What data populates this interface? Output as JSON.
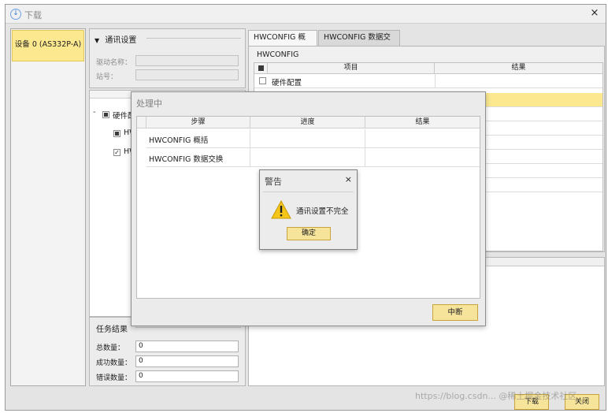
{
  "window": {
    "title": "下载",
    "close": "×"
  },
  "device": {
    "item": "设备 0 (AS332P-A)"
  },
  "comm": {
    "title": "通讯设置",
    "driver_label": "驱动名称：",
    "station_label": "站号："
  },
  "tree": {
    "collapse": "-",
    "root": "硬件配",
    "child1": "HW",
    "child2": "HW"
  },
  "results": {
    "title": "任务结果",
    "total_label": "总数量：",
    "total": "0",
    "success_label": "成功数量：",
    "success": "0",
    "error_label": "错误数量：",
    "error": "0"
  },
  "tabs": [
    {
      "label": "HWCONFIG 概括"
    },
    {
      "label": "HWCONFIG 数据交换"
    }
  ],
  "hwconfig": {
    "label": "HWCONFIG",
    "col_item": "项目",
    "col_result": "结果",
    "row1": "硬件配置"
  },
  "buttons": {
    "download": "下载",
    "close": "关闭"
  },
  "processing": {
    "title": "处理中",
    "col_step": "步骤",
    "col_progress": "进度",
    "col_result": "结果",
    "rows": [
      {
        "step": "HWCONFIG 概括"
      },
      {
        "step": "HWCONFIG 数据交换"
      }
    ],
    "abort": "中断"
  },
  "warning": {
    "title": "警告",
    "close": "×",
    "icon": "warning-triangle-icon",
    "message": "通讯设置不完全",
    "ok": "确定"
  },
  "watermark": "https://blog.csdn... @稀土掘金技术社区"
}
